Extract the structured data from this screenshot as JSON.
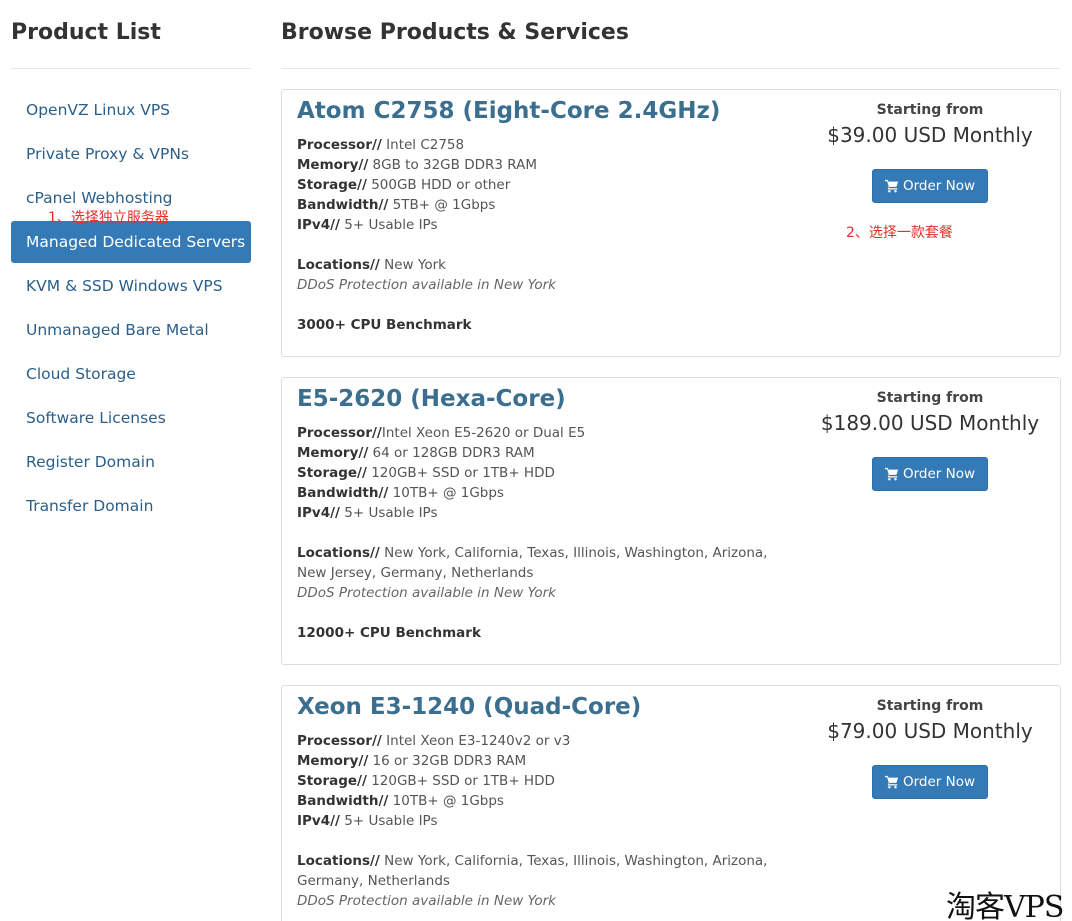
{
  "sidebar": {
    "title": "Product List",
    "items": [
      {
        "label": "OpenVZ Linux VPS"
      },
      {
        "label": "Private Proxy & VPNs"
      },
      {
        "label": "cPanel Webhosting"
      },
      {
        "label": "Managed Dedicated Servers",
        "active": true
      },
      {
        "label": "KVM & SSD Windows VPS"
      },
      {
        "label": "Unmanaged Bare Metal"
      },
      {
        "label": "Cloud Storage"
      },
      {
        "label": "Software Licenses"
      },
      {
        "label": "Register Domain"
      },
      {
        "label": "Transfer Domain"
      }
    ]
  },
  "main": {
    "title": "Browse Products & Services",
    "products": [
      {
        "name": "Atom C2758 (Eight-Core 2.4GHz)",
        "processor_label": "Processor//",
        "processor": " Intel C2758",
        "memory_label": "Memory//",
        "memory": " 8GB to 32GB DDR3 RAM",
        "storage_label": "Storage//",
        "storage": " 500GB HDD or other",
        "bandwidth_label": "Bandwidth//",
        "bandwidth": " 5TB+ @ 1Gbps",
        "ipv4_label": "IPv4//",
        "ipv4": " 5+ Usable IPs",
        "locations_label": "Locations//",
        "locations_line1": " New York",
        "locations_line2": "",
        "ddos": "DDoS Protection available in New York",
        "benchmark": "3000+ CPU Benchmark",
        "starting_from": "Starting from",
        "price": "$39.00 USD Monthly",
        "order_label": "Order Now"
      },
      {
        "name": "E5-2620 (Hexa-Core)",
        "processor_label": "Processor//",
        "processor": "Intel Xeon E5-2620 or Dual E5",
        "memory_label": "Memory//",
        "memory": " 64 or 128GB DDR3 RAM",
        "storage_label": "Storage//",
        "storage": " 120GB+ SSD or 1TB+ HDD",
        "bandwidth_label": "Bandwidth//",
        "bandwidth": " 10TB+ @ 1Gbps",
        "ipv4_label": "IPv4//",
        "ipv4": " 5+ Usable IPs",
        "locations_label": "Locations//",
        "locations_line1": " New York, California, Texas, Illinois, Washington, Arizona,",
        "locations_line2": "New Jersey, Germany, Netherlands",
        "ddos": "DDoS Protection available in New York",
        "benchmark": "12000+ CPU Benchmark",
        "starting_from": "Starting from",
        "price": "$189.00 USD Monthly",
        "order_label": "Order Now"
      },
      {
        "name": "Xeon E3-1240 (Quad-Core)",
        "processor_label": "Processor//",
        "processor": " Intel Xeon E3-1240v2 or v3",
        "memory_label": "Memory//",
        "memory": " 16 or 32GB DDR3 RAM",
        "storage_label": "Storage//",
        "storage": " 120GB+ SSD or 1TB+ HDD",
        "bandwidth_label": "Bandwidth//",
        "bandwidth": " 10TB+ @ 1Gbps",
        "ipv4_label": "IPv4//",
        "ipv4": " 5+ Usable IPs",
        "locations_label": "Locations//",
        "locations_line1": " New York, California, Texas, Illinois, Washington, Arizona,",
        "locations_line2": "Germany, Netherlands",
        "ddos": "DDoS Protection available in New York",
        "starting_from": "Starting from",
        "price": "$79.00 USD Monthly",
        "order_label": "Order Now"
      }
    ]
  },
  "annotations": {
    "step1": "1、选择独立服务器",
    "step2": "2、选择一款套餐"
  },
  "watermark": "淘客VPS",
  "colors": {
    "accent": "#337ab7",
    "product_title": "#3a6f8f",
    "link": "#2b5f8a",
    "annotation": "#e0302a"
  },
  "icons": {
    "order_button": "shopping-cart-icon"
  }
}
